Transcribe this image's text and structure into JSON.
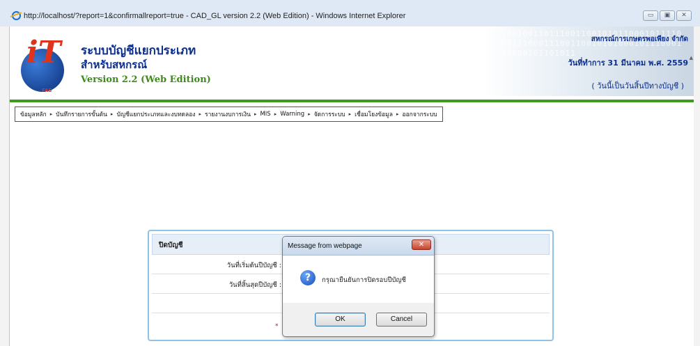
{
  "window": {
    "title": "http://localhost/?report=1&confirmallreport=true - CAD_GL version 2.2 (Web Edition) - Windows Internet Explorer",
    "min_btn": "▭",
    "max_btn": "▣",
    "close_btn": "✕"
  },
  "header": {
    "binary": "1011001101110011001010110001011110001110001110011001010100010111000111000101101011",
    "brand_line1": "ระบบบัญชีแยกประเภท",
    "brand_line2": "สำหรับสหกรณ์",
    "brand_line3": "Version 2.2 (Web Edition)",
    "logo_text": "iT",
    "logo_fas": "FAS",
    "coop_name": "สหกรณ์การเกษตรพอเพียง จำกัด",
    "work_date": "วันที่ทำการ 31 มีนาคม พ.ศ. 2559",
    "year_end_note": "( วันนี้เป็นวันสิ้นปีทางบัญชี )"
  },
  "menu": {
    "items": [
      "ข้อมูลหลัก",
      "บันทึกรายการขั้นต้น",
      "บัญชีแยกประเภทและงบทดลอง",
      "รายงานงบการเงิน",
      "MIS",
      "Warning",
      "จัดการระบบ",
      "เชื่อมโยงข้อมูล",
      "ออกจากระบบ"
    ],
    "arrow": "▸"
  },
  "panel": {
    "title": "ปิดบัญชี",
    "row1_label": "วันที่เริ่มต้นปีบัญชี :",
    "row2_label": "วันที่สิ้นสุดปีบัญชี :",
    "red_text": "*"
  },
  "dialog": {
    "title": "Message from webpage",
    "close": "✕",
    "icon": "?",
    "message": "กรุณายืนยันการปิดรอบปีบัญชี",
    "ok_label": "OK",
    "cancel_label": "Cancel"
  }
}
